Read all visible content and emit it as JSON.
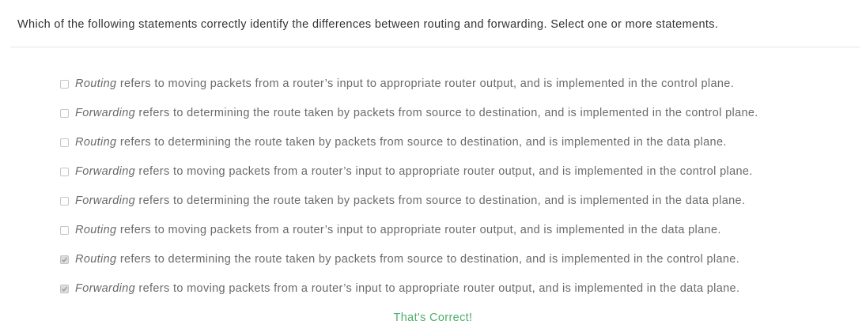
{
  "question": {
    "text": "Which of the following statements correctly identify the differences between routing and forwarding. Select one or more statements."
  },
  "options": [
    {
      "term": "Routing",
      "rest": " refers to moving packets from a router’s input to appropriate router output, and is implemented in the control plane.",
      "checked": false
    },
    {
      "term": "Forwarding",
      "rest": " refers to determining the route taken by packets from source to destination, and is implemented in the control plane.",
      "checked": false
    },
    {
      "term": "Routing",
      "rest": " refers to determining the route taken by packets from source to destination, and is implemented in the data plane.",
      "checked": false
    },
    {
      "term": "Forwarding",
      "rest": " refers to moving packets from a router’s input to appropriate router output, and is implemented in the control plane.",
      "checked": false
    },
    {
      "term": "Forwarding",
      "rest": " refers to determining the route taken by packets from source to destination, and is implemented in the data plane.",
      "checked": false
    },
    {
      "term": "Routing",
      "rest": " refers to moving packets from a router’s input to appropriate router output, and is implemented in the data plane.",
      "checked": false
    },
    {
      "term": "Routing",
      "rest": " refers to determining the route taken by packets from source to destination, and is implemented in the control plane.",
      "checked": true
    },
    {
      "term": "Forwarding",
      "rest": " refers to moving packets from a router’s input to appropriate router output, and is implemented in the data plane.",
      "checked": true
    }
  ],
  "feedback": {
    "text": "That's Correct!",
    "color": "#4caf6a"
  },
  "colors": {
    "option_text": "#6a6a6a",
    "question_text": "#333333"
  }
}
